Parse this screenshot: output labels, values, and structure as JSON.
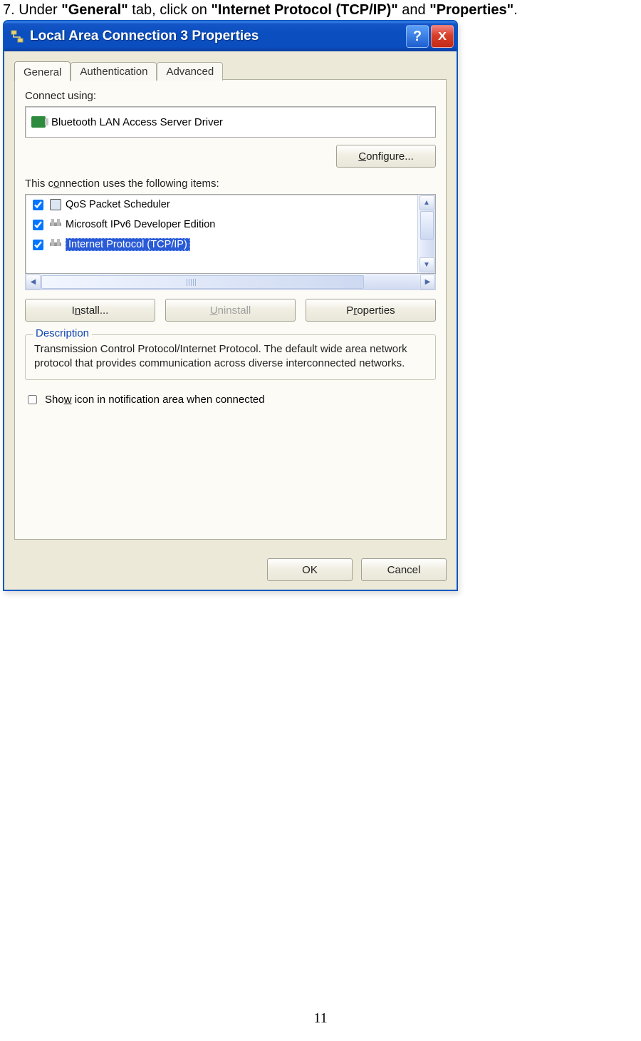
{
  "instruction": {
    "prefix": "7. Under ",
    "bold1": "\"General\"",
    "mid1": " tab, click on ",
    "bold2": "\"Internet Protocol (TCP/IP)\"",
    "mid2": " and ",
    "bold3": "\"Properties\"",
    "suffix": "."
  },
  "dialog": {
    "title": "Local Area Connection 3 Properties",
    "tabs": {
      "general": "General",
      "auth": "Authentication",
      "advanced": "Advanced"
    },
    "connect_using_label": "Connect using:",
    "adapter": "Bluetooth LAN Access Server Driver",
    "configure_btn": "Configure...",
    "items_label": "This connection uses the following items:",
    "items": [
      {
        "checked": true,
        "icon": "mon",
        "label": "QoS Packet Scheduler"
      },
      {
        "checked": true,
        "icon": "net",
        "label": "Microsoft IPv6 Developer Edition"
      },
      {
        "checked": true,
        "icon": "net",
        "label": "Internet Protocol (TCP/IP)",
        "selected": true
      }
    ],
    "install_btn": "Install...",
    "uninstall_btn": "Uninstall",
    "properties_btn": "Properties",
    "description_legend": "Description",
    "description_text": "Transmission Control Protocol/Internet Protocol. The default wide area network protocol that provides communication across diverse interconnected networks.",
    "show_icon_label": "Show icon in notification area when connected",
    "ok_btn": "OK",
    "cancel_btn": "Cancel"
  },
  "page_number": "11"
}
